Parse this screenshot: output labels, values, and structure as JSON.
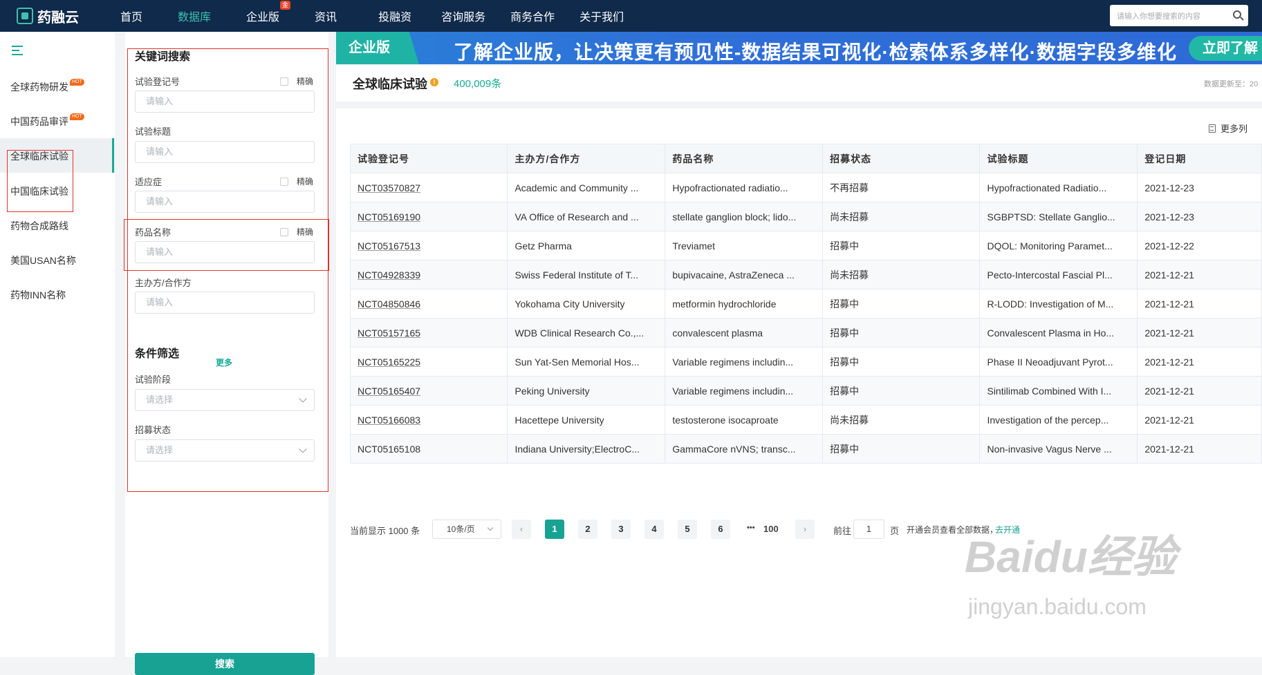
{
  "nav": {
    "logo": "药融云",
    "items": [
      {
        "label": "首页",
        "active": false
      },
      {
        "label": "数据库",
        "active": true
      },
      {
        "label": "企业版",
        "active": false,
        "badge": "金"
      },
      {
        "label": "资讯",
        "active": false
      },
      {
        "label": "投融资",
        "active": false
      },
      {
        "label": "咨询服务",
        "active": false
      },
      {
        "label": "商务合作",
        "active": false
      },
      {
        "label": "关于我们",
        "active": false
      }
    ],
    "search_placeholder": "请输入你想要搜索的内容"
  },
  "sidebar": {
    "hot_label": "HOT",
    "items": [
      {
        "label": "全球药物研发",
        "hot": true
      },
      {
        "label": "中国药品审评",
        "hot": true
      },
      {
        "label": "全球临床试验",
        "active": true
      },
      {
        "label": "中国临床试验"
      },
      {
        "label": "药物合成路线"
      },
      {
        "label": "美国USAN名称"
      },
      {
        "label": "药物INN名称"
      }
    ]
  },
  "filter": {
    "keyword_title": "关键词搜索",
    "exact_label": "精确",
    "input_placeholder": "请输入",
    "select_placeholder": "请选择",
    "fields": {
      "reg_no": "试验登记号",
      "title": "试验标题",
      "indication": "适应症",
      "drug": "药品名称",
      "sponsor": "主办方/合作方"
    },
    "more": "更多",
    "condition_title": "条件筛选",
    "phase": "试验阶段",
    "status": "招募状态",
    "search_button": "搜索"
  },
  "banner": {
    "tag": "企业版",
    "text": "了解企业版，让决策更有预见性-数据结果可视化·检索体系多样化·数据字段多维化",
    "button": "立即了解"
  },
  "header": {
    "title": "全球临床试验",
    "count": "400,009条",
    "update": "数据更新至：20"
  },
  "table": {
    "more_cols": "更多列",
    "columns": [
      "试验登记号",
      "主办方/合作方",
      "药品名称",
      "招募状态",
      "试验标题",
      "登记日期"
    ],
    "rows": [
      [
        "NCT03570827",
        "Academic and Community ...",
        "Hypofractionated radiatio...",
        "不再招募",
        "Hypofractionated Radiatio...",
        "2021-12-23"
      ],
      [
        "NCT05169190",
        "VA Office of Research and ...",
        "stellate ganglion block; lido...",
        "尚未招募",
        "SGBPTSD: Stellate Ganglio...",
        "2021-12-23"
      ],
      [
        "NCT05167513",
        "Getz Pharma",
        "Treviamet",
        "招募中",
        "DQOL: Monitoring Paramet...",
        "2021-12-22"
      ],
      [
        "NCT04928339",
        "Swiss Federal Institute of T...",
        "bupivacaine, AstraZeneca ...",
        "尚未招募",
        "Pecto-Intercostal Fascial Pl...",
        "2021-12-21"
      ],
      [
        "NCT04850846",
        "Yokohama City University",
        "metformin hydrochloride",
        "招募中",
        "R-LODD: Investigation of M...",
        "2021-12-21"
      ],
      [
        "NCT05157165",
        "WDB Clinical Research Co.,...",
        "convalescent plasma",
        "招募中",
        "Convalescent Plasma in Ho...",
        "2021-12-21"
      ],
      [
        "NCT05165225",
        "Sun Yat-Sen Memorial Hos...",
        "Variable regimens includin...",
        "招募中",
        "Phase II Neoadjuvant Pyrot...",
        "2021-12-21"
      ],
      [
        "NCT05165407",
        "Peking University",
        "Variable regimens includin...",
        "招募中",
        "Sintilimab Combined With I...",
        "2021-12-21"
      ],
      [
        "NCT05166083",
        "Hacettepe University",
        "testosterone isocaproate",
        "尚未招募",
        "Investigation of the percep...",
        "2021-12-21"
      ],
      [
        "NCT05165108",
        "Indiana University;ElectroC...",
        "GammaCore nVNS; transc...",
        "招募中",
        "Non-invasive Vagus Nerve ...",
        "2021-12-21"
      ]
    ]
  },
  "pager": {
    "showing": "当前显示 1000 条",
    "page_size": "10条/页",
    "pages": [
      "1",
      "2",
      "3",
      "4",
      "5",
      "6"
    ],
    "ellipsis": "•••",
    "last": "100",
    "goto_label": "前往",
    "goto_value": "1",
    "page_unit": "页",
    "member_text": "开通会员查看全部数据，",
    "member_link": "去开通"
  },
  "watermark": {
    "brand": "Baidu经验",
    "url": "jingyan.baidu.com"
  },
  "colors": {
    "nav_bg": "#0f2a4a",
    "accent": "#17a294",
    "banner": "#2d6ad5",
    "highlight_box": "#e0312b"
  }
}
